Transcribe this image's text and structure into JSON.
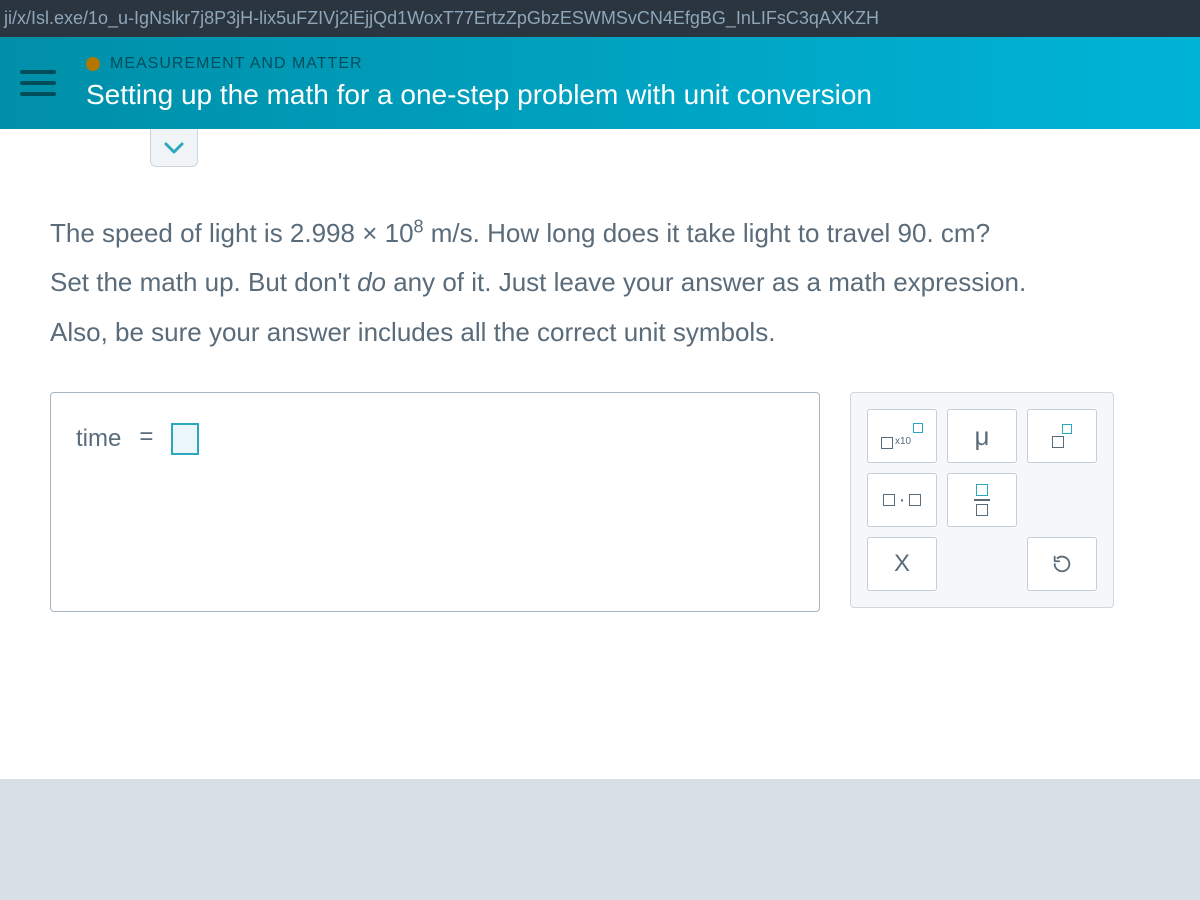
{
  "url_bar": "ji/x/Isl.exe/1o_u-IgNslkr7j8P3jH-lix5uFZIVj2iEjjQd1WoxT77ErtzZpGbzESWMSvCN4EfgBG_InLIFsC3qAXKZH",
  "header": {
    "category": "MEASUREMENT AND MATTER",
    "title": "Setting up the math for a one-step problem with unit conversion"
  },
  "question": {
    "line1_a": "The speed of light is 2.998 × 10",
    "line1_exp": "8",
    "line1_b": " m/s. How long does it take light to travel 90. cm?",
    "line2_a": "Set the math up. But don't ",
    "line2_emph": "do",
    "line2_b": " any of it. Just leave your answer as a math expression.",
    "line3": "Also, be sure your answer includes all the correct unit symbols."
  },
  "answer": {
    "label": "time",
    "equals": "="
  },
  "palette": {
    "sci_label": "x10",
    "mu": "μ",
    "dot": "·",
    "clear": "X"
  }
}
